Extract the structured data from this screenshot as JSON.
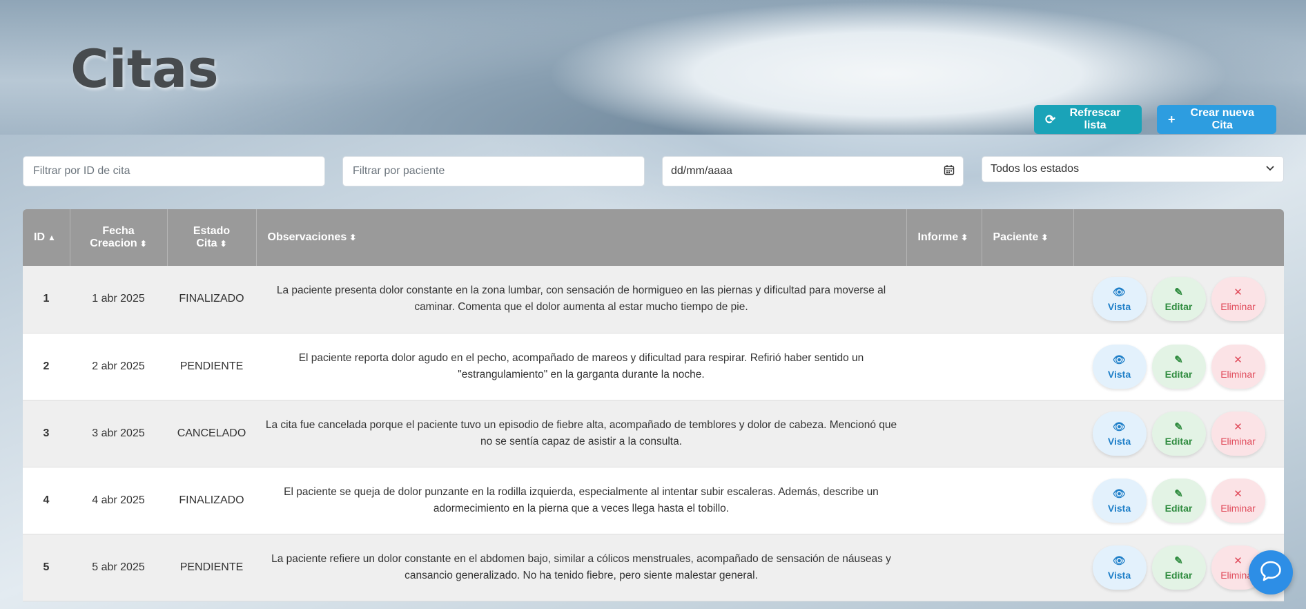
{
  "header": {
    "title": "Citas",
    "refresh_label": "Refrescar lista",
    "create_label": "Crear nueva Cita"
  },
  "filters": {
    "id_placeholder": "Filtrar por ID de cita",
    "patient_placeholder": "Filtrar por paciente",
    "date_value": "dd/mm/aaaa",
    "status_selected": "Todos los estados"
  },
  "table": {
    "columns": [
      "ID",
      "Fecha Creacion",
      "Estado Cita",
      "Observaciones",
      "Informe",
      "Paciente",
      ""
    ],
    "rows": [
      {
        "id": "1",
        "fecha": "1 abr 2025",
        "estado": "FINALIZADO",
        "obs": "La paciente presenta dolor constante en la zona lumbar, con sensación de hormigueo en las piernas y dificultad para moverse al caminar. Comenta que el dolor aumenta al estar mucho tiempo de pie.",
        "informe": "",
        "paciente": ""
      },
      {
        "id": "2",
        "fecha": "2 abr 2025",
        "estado": "PENDIENTE",
        "obs": "El paciente reporta dolor agudo en el pecho, acompañado de mareos y dificultad para respirar. Refirió haber sentido un \"estrangulamiento\" en la garganta durante la noche.",
        "informe": "",
        "paciente": ""
      },
      {
        "id": "3",
        "fecha": "3 abr 2025",
        "estado": "CANCELADO",
        "obs": "La cita fue cancelada porque el paciente tuvo un episodio de fiebre alta, acompañado de temblores y dolor de cabeza. Mencionó que no se sentía capaz de asistir a la consulta.",
        "informe": "",
        "paciente": ""
      },
      {
        "id": "4",
        "fecha": "4 abr 2025",
        "estado": "FINALIZADO",
        "obs": "El paciente se queja de dolor punzante en la rodilla izquierda, especialmente al intentar subir escaleras. Además, describe un adormecimiento en la pierna que a veces llega hasta el tobillo.",
        "informe": "",
        "paciente": ""
      },
      {
        "id": "5",
        "fecha": "5 abr 2025",
        "estado": "PENDIENTE",
        "obs": "La paciente refiere un dolor constante en el abdomen bajo, similar a cólicos menstruales, acompañado de sensación de náuseas y cansancio generalizado. No ha tenido fiebre, pero siente malestar general.",
        "informe": "",
        "paciente": ""
      }
    ],
    "actions": {
      "view": "Vista",
      "edit": "Editar",
      "delete": "Eliminar"
    }
  },
  "colors": {
    "refresh": "#1aa3b8",
    "create": "#2d9de0",
    "header_bg": "#9a9a9a",
    "view": "#1f7fc8",
    "edit": "#2e8b3e",
    "delete": "#e04a5a"
  },
  "icons": {
    "refresh": "refresh-icon",
    "plus": "plus-icon",
    "calendar": "calendar-icon",
    "chevron": "chevron-down-icon",
    "eye": "eye-icon",
    "pencil": "pencil-icon",
    "close": "close-icon",
    "chat": "chat-icon",
    "sort": "sort-icon"
  }
}
